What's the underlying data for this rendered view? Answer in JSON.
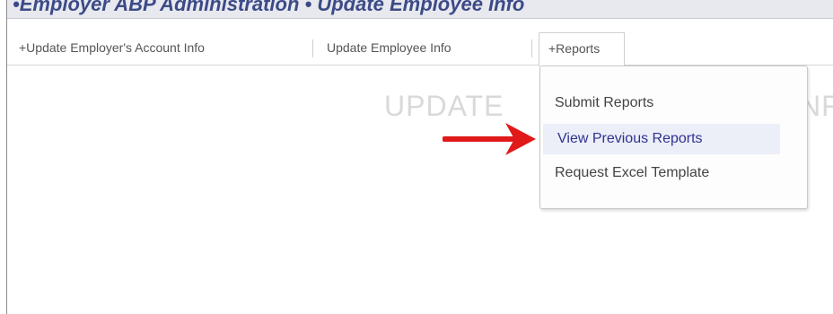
{
  "header": {
    "title": "•Employer ABP Administration • Update Employee Info"
  },
  "tabs": {
    "update_employer": "+Update Employer's Account Info",
    "update_employee": "Update Employee Info",
    "reports": "+Reports"
  },
  "main": {
    "watermark_left": "UPDATE",
    "watermark_right": "NF"
  },
  "reports_menu": {
    "items": [
      {
        "label": "Submit Reports"
      },
      {
        "label": "View Previous Reports",
        "highlighted": true
      },
      {
        "label": "Request Excel Template"
      }
    ]
  },
  "annotation": {
    "arrow_color": "#e11919"
  }
}
